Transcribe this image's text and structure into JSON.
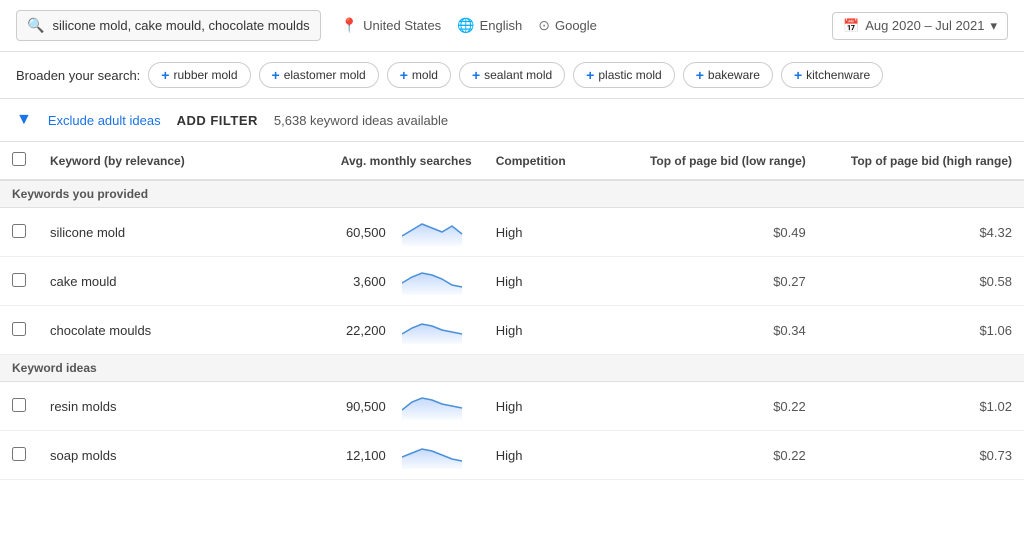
{
  "searchBar": {
    "searchText": "silicone mold, cake mould, chocolate moulds",
    "location": "United States",
    "language": "English",
    "engine": "Google",
    "dateRange": "Aug 2020 – Jul 2021"
  },
  "broadenSearch": {
    "label": "Broaden your search:",
    "chips": [
      "rubber mold",
      "elastomer mold",
      "mold",
      "sealant mold",
      "plastic mold",
      "bakeware",
      "kitchenware"
    ]
  },
  "filterBar": {
    "excludeLabel": "Exclude adult ideas",
    "addFilterLabel": "ADD FILTER",
    "ideasCount": "5,638 keyword ideas available"
  },
  "table": {
    "headers": {
      "keyword": "Keyword (by relevance)",
      "avgMonthly": "Avg. monthly searches",
      "competition": "Competition",
      "bidLow": "Top of page bid (low range)",
      "bidHigh": "Top of page bid (high range)"
    },
    "sections": [
      {
        "sectionLabel": "Keywords you provided",
        "rows": [
          {
            "keyword": "silicone mold",
            "avg": "60,500",
            "competition": "High",
            "bidLow": "$0.49",
            "bidHigh": "$4.32"
          },
          {
            "keyword": "cake mould",
            "avg": "3,600",
            "competition": "High",
            "bidLow": "$0.27",
            "bidHigh": "$0.58"
          },
          {
            "keyword": "chocolate moulds",
            "avg": "22,200",
            "competition": "High",
            "bidLow": "$0.34",
            "bidHigh": "$1.06"
          }
        ]
      },
      {
        "sectionLabel": "Keyword ideas",
        "rows": [
          {
            "keyword": "resin molds",
            "avg": "90,500",
            "competition": "High",
            "bidLow": "$0.22",
            "bidHigh": "$1.02"
          },
          {
            "keyword": "soap molds",
            "avg": "12,100",
            "competition": "High",
            "bidLow": "$0.22",
            "bidHigh": "$0.73"
          }
        ]
      }
    ]
  }
}
